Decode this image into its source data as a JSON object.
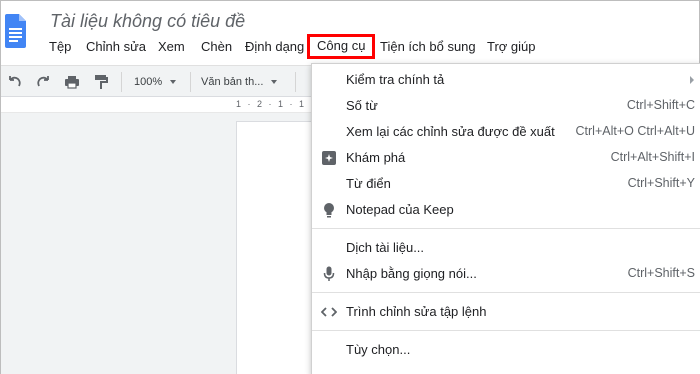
{
  "header": {
    "title": "Tài liệu không có tiêu đề"
  },
  "menubar": {
    "items": [
      {
        "label": "Tệp"
      },
      {
        "label": "Chỉnh sửa"
      },
      {
        "label": "Xem"
      },
      {
        "label": "Chèn"
      },
      {
        "label": "Định dạng"
      },
      {
        "label": "Công cụ"
      },
      {
        "label": "Tiện ích bổ sung"
      },
      {
        "label": "Trợ giúp"
      }
    ],
    "active_highlight_color": "#ff0000"
  },
  "toolbar": {
    "zoom": "100%",
    "style": "Văn bản th..."
  },
  "ruler": {
    "text": "1 · 2 · 1 · 1"
  },
  "tools_menu": {
    "items": [
      {
        "label": "Kiểm tra chính tả",
        "shortcut": "",
        "icon": "",
        "submenu": true
      },
      {
        "label": "Số từ",
        "shortcut": "Ctrl+Shift+C",
        "icon": ""
      },
      {
        "label": "Xem lại các chỉnh sửa được đề xuất",
        "shortcut": "Ctrl+Alt+O Ctrl+Alt+U",
        "icon": ""
      },
      {
        "label": "Khám phá",
        "shortcut": "Ctrl+Alt+Shift+I",
        "icon": "explore-icon"
      },
      {
        "label": "Từ điển",
        "shortcut": "Ctrl+Shift+Y",
        "icon": ""
      },
      {
        "label": "Notepad của Keep",
        "shortcut": "",
        "icon": "lightbulb-icon"
      },
      {
        "label": "Dịch tài liệu...",
        "shortcut": "",
        "icon": ""
      },
      {
        "label": "Nhập bằng giọng nói...",
        "shortcut": "Ctrl+Shift+S",
        "icon": "microphone-icon"
      },
      {
        "label": "Trình chỉnh sửa tập lệnh",
        "shortcut": "",
        "icon": "code-icon"
      },
      {
        "label": "Tùy chọn...",
        "shortcut": "",
        "icon": ""
      }
    ]
  },
  "colors": {
    "doc_blue": "#4285f4",
    "icon_gray": "#5f6368"
  }
}
